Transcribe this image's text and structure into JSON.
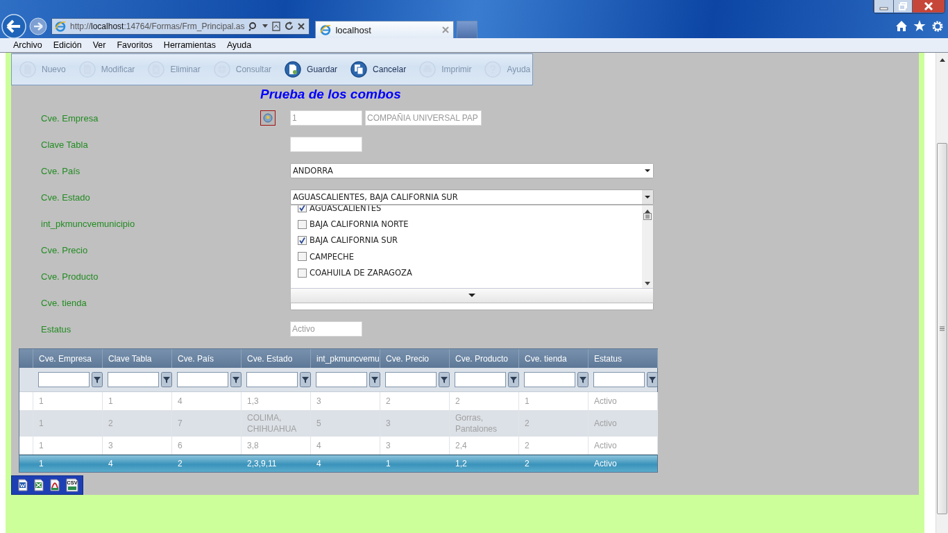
{
  "browser": {
    "address": "http://**localhost**:14764/Formas/Frm_Principal.as",
    "tabs": [
      {
        "title": "localhost",
        "selected": true
      }
    ]
  },
  "menu": [
    "Archivo",
    "Edición",
    "Ver",
    "Favoritos",
    "Herramientas",
    "Ayuda"
  ],
  "toolbar": [
    {
      "label": "Nuevo",
      "kind": "new",
      "disabled": true
    },
    {
      "label": "Modificar",
      "kind": "edit",
      "disabled": true
    },
    {
      "label": "Eliminar",
      "kind": "delete",
      "disabled": true
    },
    {
      "label": "Consultar",
      "kind": "query",
      "disabled": true
    },
    {
      "label": "Guardar",
      "kind": "save",
      "disabled": false
    },
    {
      "label": "Cancelar",
      "kind": "cancel",
      "disabled": false
    },
    {
      "label": "Imprimir",
      "kind": "print",
      "disabled": true
    },
    {
      "label": "Ayuda",
      "kind": "help",
      "disabled": true
    }
  ],
  "title": "Prueba de los combos",
  "form": [
    {
      "label": "Cve. Empresa",
      "kind": "lookup",
      "code": "1",
      "name": "COMPAÑIA UNIVERSAL PAP",
      "disabled": true
    },
    {
      "label": "Clave Tabla",
      "kind": "text"
    },
    {
      "label": "Cve. País",
      "kind": "select",
      "value": "ANDORRA"
    },
    {
      "label": "Cve. Estado",
      "kind": "multiselect",
      "value": "AGUASCALIENTES, BAJA CALIFORNIA SUR",
      "expanded": true,
      "options": [
        {
          "label": "AGUASCALIENTES",
          "checked": true
        },
        {
          "label": "BAJA CALIFORNIA NORTE",
          "checked": false
        },
        {
          "label": "BAJA CALIFORNIA SUR",
          "checked": true
        },
        {
          "label": "CAMPECHE",
          "checked": false
        },
        {
          "label": "COAHUILA DE ZARAGOZA",
          "checked": false
        }
      ]
    },
    {
      "label": "int_pkmuncvemunicipio",
      "kind": "covered"
    },
    {
      "label": "Cve. Precio",
      "kind": "covered"
    },
    {
      "label": "Cve. Producto",
      "kind": "covered"
    },
    {
      "label": "Cve. tienda",
      "kind": "select"
    },
    {
      "label": "Estatus",
      "kind": "text",
      "value": "Activo",
      "disabled": true
    }
  ],
  "grid": {
    "columns": [
      "Cve. Empresa",
      "Clave Tabla",
      "Cve. País",
      "Cve. Estado",
      "int_pkmuncvemu",
      "Cve. Precio",
      "Cve. Producto",
      "Cve. tienda",
      "Estatus"
    ],
    "rows": [
      {
        "cells": [
          "1",
          "1",
          "4",
          "1,3",
          "3",
          "2",
          "2",
          "1",
          "Activo"
        ],
        "selected": false
      },
      {
        "cells": [
          "1",
          "2",
          "7",
          "COLIMA, CHIHUAHUA",
          "5",
          "3",
          "Gorras, Pantalones",
          "2",
          "Activo"
        ],
        "selected": false
      },
      {
        "cells": [
          "1",
          "3",
          "6",
          "3,8",
          "4",
          "3",
          "2,4",
          "2",
          "Activo"
        ],
        "selected": false
      },
      {
        "cells": [
          "1",
          "4",
          "2",
          "2,3,9,11",
          "4",
          "1",
          "1,2",
          "2",
          "Activo"
        ],
        "selected": true
      }
    ]
  },
  "export": [
    {
      "kind": "word"
    },
    {
      "kind": "excel"
    },
    {
      "kind": "pdf"
    },
    {
      "kind": "csv",
      "label": "CSV"
    }
  ]
}
